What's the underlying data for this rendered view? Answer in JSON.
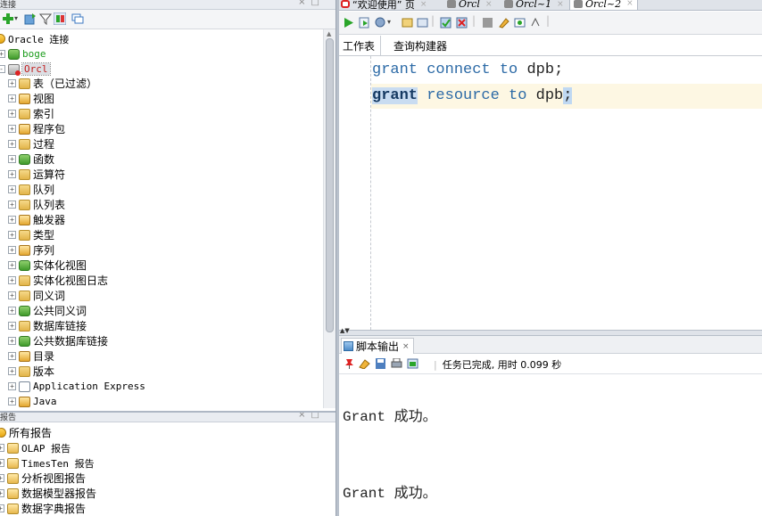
{
  "left_panel": {
    "title": "连接",
    "root": "Oracle 连接",
    "connections": [
      {
        "name": "boge",
        "color": "#1a9b1a"
      },
      {
        "name": "Orcl",
        "color": "#c21b1b"
      }
    ],
    "orcl_children": [
      "表（已过滤）",
      "视图",
      "索引",
      "程序包",
      "过程",
      "函数",
      "运算符",
      "队列",
      "队列表",
      "触发器",
      "类型",
      "序列",
      "实体化视图",
      "实体化视图日志",
      "同义词",
      "公共同义词",
      "数据库链接",
      "公共数据库链接",
      "目录",
      "版本",
      "Application Express",
      "Java"
    ]
  },
  "reports_panel": {
    "title": "报告",
    "root": "所有报告",
    "items": [
      "OLAP 报告",
      "TimesTen 报告",
      "分析视图报告",
      "数据模型器报告",
      "数据字典报告"
    ]
  },
  "editor": {
    "doc_tabs": [
      {
        "label": "“欢迎使用” 页",
        "italic": false
      },
      {
        "label": "Orcl",
        "italic": true
      },
      {
        "label": "Orcl~1",
        "italic": true
      },
      {
        "label": "Orcl~2",
        "italic": true
      }
    ],
    "sub_tabs": [
      "工作表",
      "查询构建器"
    ],
    "code_lines": [
      {
        "kw1": "grant",
        "kw2": "connect",
        "kw3": "to",
        "id": "dpb",
        "end": ";"
      },
      {
        "kw1": "grant",
        "kw2": "resource",
        "kw3": "to",
        "id": "dpb",
        "end": ";"
      }
    ]
  },
  "output": {
    "tab_label": "脚本输出",
    "status": "任务已完成, 用时 0.099 秒",
    "lines": [
      "Grant 成功。",
      "Grant 成功。"
    ]
  },
  "colors": {
    "keyword": "#2c6aa6",
    "boge": "#1a9b1a",
    "orcl": "#c21b1b",
    "active_line": "#fdf7e3",
    "selection": "#c9dcf1"
  }
}
